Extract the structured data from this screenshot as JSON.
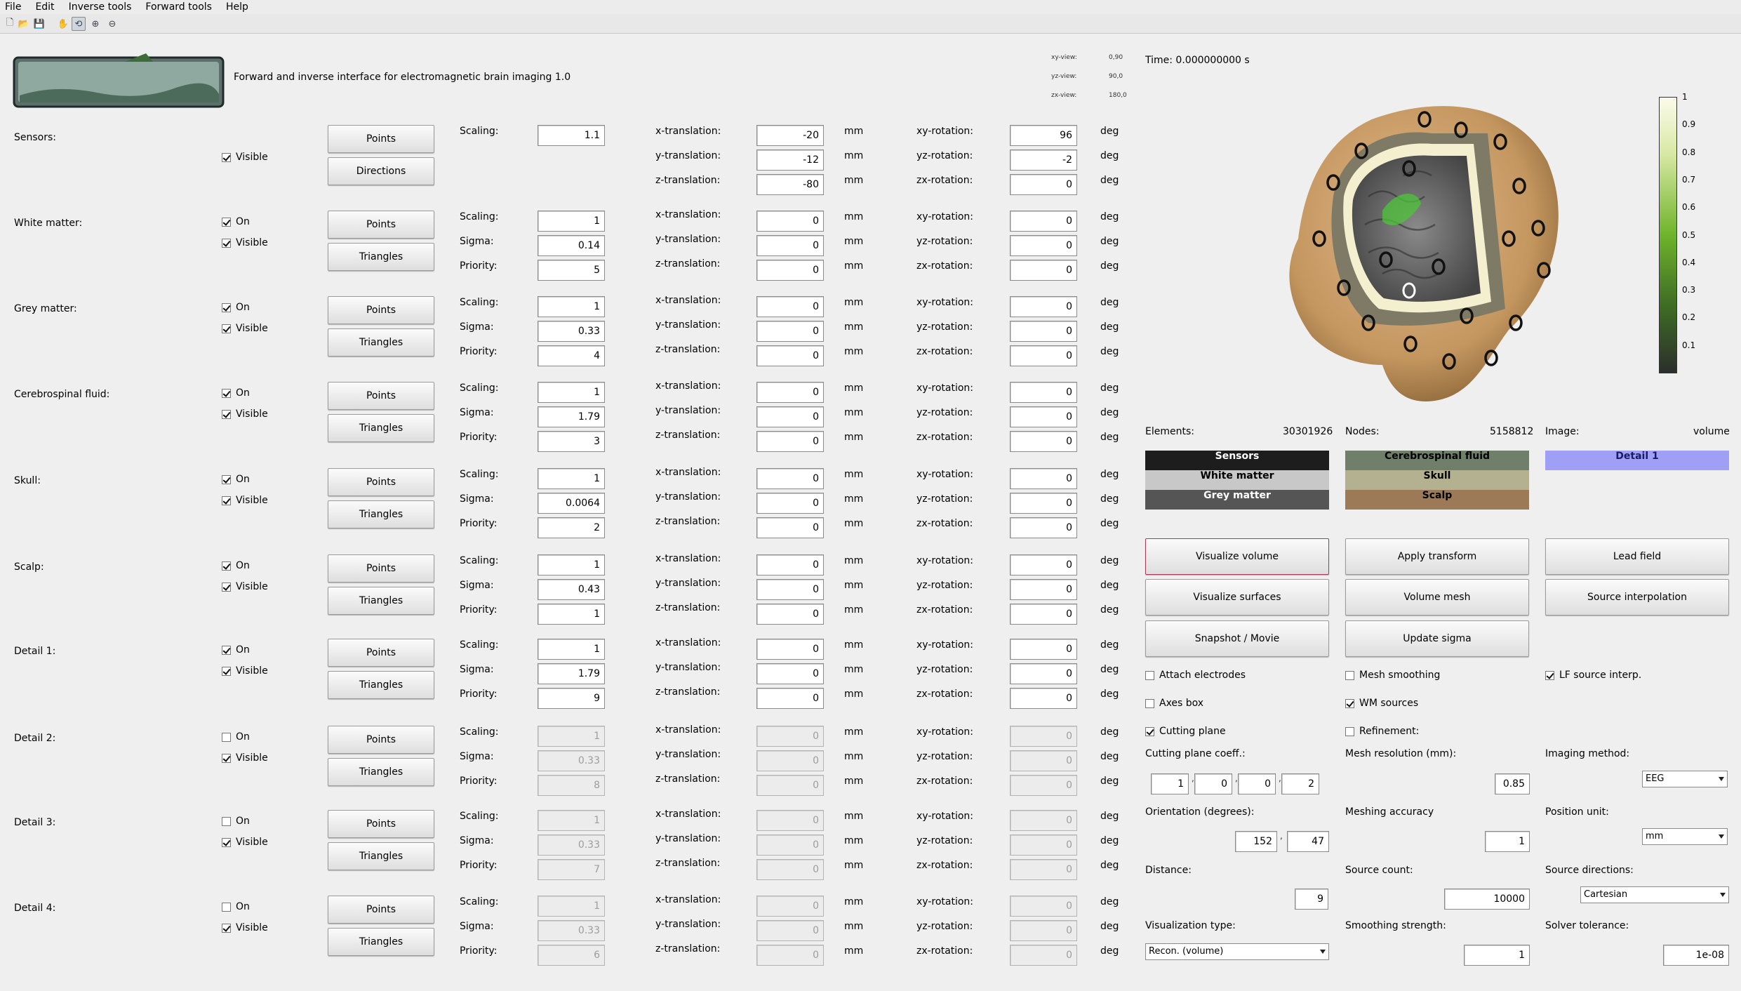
{
  "menu": [
    "File",
    "Edit",
    "Inverse tools",
    "Forward tools",
    "Help"
  ],
  "toolbar": [
    "new-icon",
    "open-icon",
    "save-icon",
    "pan-icon",
    "rotate-icon",
    "zoom-in-icon",
    "zoom-out-icon"
  ],
  "header": {
    "title": "Forward and inverse interface for electromagnetic brain imaging 1.0",
    "views": [
      {
        "label": "xy-view:",
        "value": "0,90"
      },
      {
        "label": "yz-view:",
        "value": "90,0"
      },
      {
        "label": "zx-view:",
        "value": "180,0"
      }
    ],
    "time": "Time: 0.000000000 s"
  },
  "labels": {
    "scaling": "Scaling:",
    "sigma": "Sigma:",
    "priority": "Priority:",
    "xt": "x-translation:",
    "yt": "y-translation:",
    "zt": "z-translation:",
    "xr": "xy-rotation:",
    "yr": "yz-rotation:",
    "zr": "zx-rotation:",
    "mm": "mm",
    "deg": "deg",
    "on": "On",
    "visible": "Visible",
    "points": "Points",
    "triangles": "Triangles",
    "directions": "Directions"
  },
  "sensors": {
    "label": "Sensors:",
    "visible": true,
    "scaling": "1.1",
    "xt": "-20",
    "yt": "-12",
    "zt": "-80",
    "xr": "96",
    "yr": "-2",
    "zr": "0"
  },
  "compartments": [
    {
      "label": "White matter:",
      "on": true,
      "visible": true,
      "enabled": true,
      "scaling": "1",
      "sigma": "0.14",
      "priority": "5",
      "xt": "0",
      "yt": "0",
      "zt": "0",
      "xr": "0",
      "yr": "0",
      "zr": "0"
    },
    {
      "label": "Grey matter:",
      "on": true,
      "visible": true,
      "enabled": true,
      "scaling": "1",
      "sigma": "0.33",
      "priority": "4",
      "xt": "0",
      "yt": "0",
      "zt": "0",
      "xr": "0",
      "yr": "0",
      "zr": "0"
    },
    {
      "label": "Cerebrospinal fluid:",
      "on": true,
      "visible": true,
      "enabled": true,
      "scaling": "1",
      "sigma": "1.79",
      "priority": "3",
      "xt": "0",
      "yt": "0",
      "zt": "0",
      "xr": "0",
      "yr": "0",
      "zr": "0"
    },
    {
      "label": "Skull:",
      "on": true,
      "visible": true,
      "enabled": true,
      "scaling": "1",
      "sigma": "0.0064",
      "priority": "2",
      "xt": "0",
      "yt": "0",
      "zt": "0",
      "xr": "0",
      "yr": "0",
      "zr": "0"
    },
    {
      "label": "Scalp:",
      "on": true,
      "visible": true,
      "enabled": true,
      "scaling": "1",
      "sigma": "0.43",
      "priority": "1",
      "xt": "0",
      "yt": "0",
      "zt": "0",
      "xr": "0",
      "yr": "0",
      "zr": "0"
    },
    {
      "label": "Detail 1:",
      "on": true,
      "visible": true,
      "enabled": true,
      "scaling": "1",
      "sigma": "1.79",
      "priority": "9",
      "xt": "0",
      "yt": "0",
      "zt": "0",
      "xr": "0",
      "yr": "0",
      "zr": "0"
    },
    {
      "label": "Detail 2:",
      "on": false,
      "visible": true,
      "enabled": false,
      "scaling": "1",
      "sigma": "0.33",
      "priority": "8",
      "xt": "0",
      "yt": "0",
      "zt": "0",
      "xr": "0",
      "yr": "0",
      "zr": "0"
    },
    {
      "label": "Detail 3:",
      "on": false,
      "visible": true,
      "enabled": false,
      "scaling": "1",
      "sigma": "0.33",
      "priority": "7",
      "xt": "0",
      "yt": "0",
      "zt": "0",
      "xr": "0",
      "yr": "0",
      "zr": "0"
    },
    {
      "label": "Detail 4:",
      "on": false,
      "visible": true,
      "enabled": false,
      "scaling": "1",
      "sigma": "0.33",
      "priority": "6",
      "xt": "0",
      "yt": "0",
      "zt": "0",
      "xr": "0",
      "yr": "0",
      "zr": "0"
    }
  ],
  "colorbar": {
    "ticks": [
      "1",
      "0.9",
      "0.8",
      "0.7",
      "0.6",
      "0.5",
      "0.4",
      "0.3",
      "0.2",
      "0.1"
    ]
  },
  "stats": {
    "elements_label": "Elements:",
    "elements": "30301926",
    "nodes_label": "Nodes:",
    "nodes": "5158812",
    "image_label": "Image:",
    "image": "volume"
  },
  "legend": [
    {
      "label": "Sensors",
      "bg": "#1d1d1d",
      "fg": "#ffffff"
    },
    {
      "label": "White matter",
      "bg": "#c8c8c8",
      "fg": "#000000"
    },
    {
      "label": "Grey matter",
      "bg": "#555555",
      "fg": "#ffffff"
    },
    {
      "label": "Cerebrospinal fluid",
      "bg": "#6f7f6a",
      "fg": "#000000"
    },
    {
      "label": "Skull",
      "bg": "#b3b190",
      "fg": "#000000"
    },
    {
      "label": "Scalp",
      "bg": "#9c7a58",
      "fg": "#000000"
    },
    {
      "label": "Detail 1",
      "bg": "#9f9ff6",
      "fg": "#1a1a6a"
    }
  ],
  "actions": [
    "Visualize volume",
    "Apply transform",
    "Lead field",
    "Visualize surfaces",
    "Volume mesh",
    "Source interpolation",
    "Snapshot / Movie",
    "Update sigma"
  ],
  "options": [
    {
      "label": "Attach electrodes",
      "checked": false
    },
    {
      "label": "Mesh smoothing",
      "checked": false
    },
    {
      "label": "LF source interp.",
      "checked": true
    },
    {
      "label": "Axes box",
      "checked": false
    },
    {
      "label": "WM sources",
      "checked": true
    },
    {
      "label": "Cutting plane",
      "checked": true
    },
    {
      "label": "Refinement:",
      "checked": false
    }
  ],
  "settings": {
    "cutting_plane_label": "Cutting plane coeff.:",
    "cutting_plane": [
      "1",
      "0",
      "0",
      "2"
    ],
    "mesh_res_label": "Mesh resolution (mm):",
    "mesh_res": "0.85",
    "imaging_label": "Imaging method:",
    "imaging": "EEG",
    "orientation_label": "Orientation (degrees):",
    "orientation": [
      "152",
      "47"
    ],
    "accuracy_label": "Meshing accuracy",
    "accuracy": "1",
    "pos_unit_label": "Position unit:",
    "pos_unit": "mm",
    "distance_label": "Distance:",
    "distance": "9",
    "source_count_label": "Source count:",
    "source_count": "10000",
    "source_dir_label": "Source directions:",
    "source_dir": "Cartesian",
    "vis_type_label": "Visualization type:",
    "vis_type": "Recon. (volume)",
    "smooth_label": "Smoothing strength:",
    "smooth": "1",
    "solver_label": "Solver tolerance:",
    "solver": "1e-08",
    "sep": ","
  }
}
